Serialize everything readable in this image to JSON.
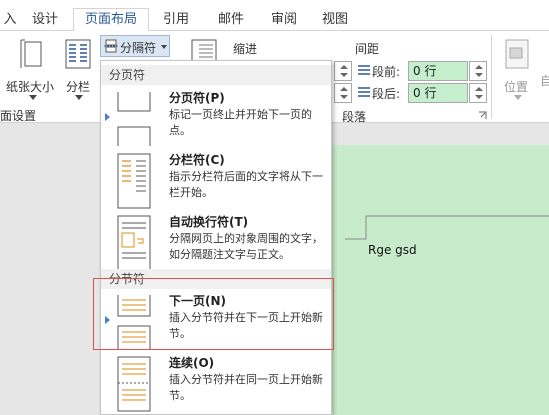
{
  "tabs": [
    {
      "label": "入",
      "active": false
    },
    {
      "label": "设计",
      "active": false
    },
    {
      "label": "页面布局",
      "active": true
    },
    {
      "label": "引用",
      "active": false
    },
    {
      "label": "邮件",
      "active": false
    },
    {
      "label": "审阅",
      "active": false
    },
    {
      "label": "视图",
      "active": false
    }
  ],
  "ribbon": {
    "paper_size": "纸张大小",
    "columns": "分栏",
    "breaks": "分隔符",
    "page_setup_group": "面设置",
    "indent_label": "缩进",
    "spacing_label": "间距",
    "before_label": "段前:",
    "before_value": "0 行",
    "after_label": "段后:",
    "after_value": "0 行",
    "paragraph_group": "段落",
    "position": "位置",
    "wrap_label_partial": "自"
  },
  "dropdown": {
    "page_breaks_header": "分页符",
    "section_breaks_header": "分节符",
    "items": [
      {
        "title": "分页符(P)",
        "desc": "标记一页终止并开始下一页的点。"
      },
      {
        "title": "分栏符(C)",
        "desc": "指示分栏符后面的文字将从下一栏开始。"
      },
      {
        "title": "自动换行符(T)",
        "desc": "分隔网页上的对象周围的文字，如分隔题注文字与正文。"
      },
      {
        "title": "下一页(N)",
        "desc": "插入分节符并在下一页上开始新节。"
      },
      {
        "title": "连续(O)",
        "desc": "插入分节符并在同一页上开始新节。"
      }
    ]
  },
  "document": {
    "text": "Rge gsd"
  }
}
